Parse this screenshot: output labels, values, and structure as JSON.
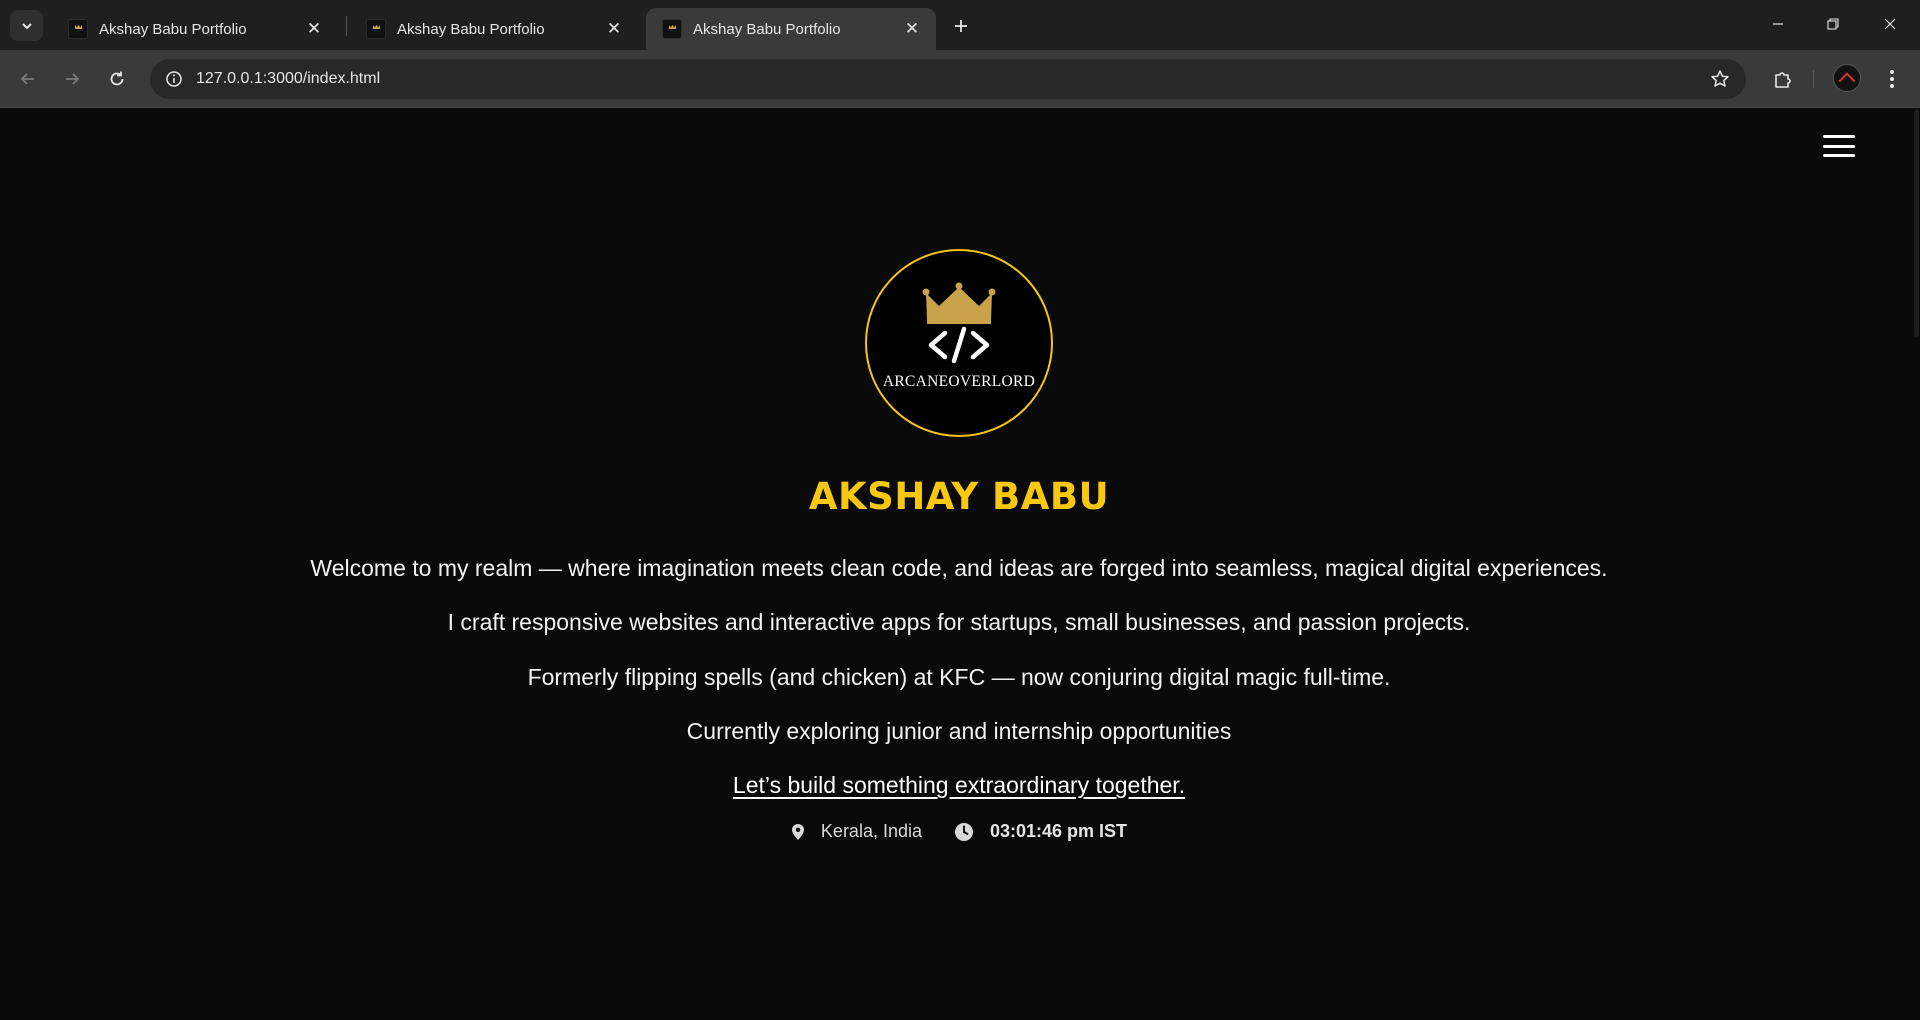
{
  "browser": {
    "tabs": [
      {
        "title": "Akshay Babu Portfolio",
        "active": false
      },
      {
        "title": "Akshay Babu Portfolio",
        "active": false
      },
      {
        "title": "Akshay Babu Portfolio",
        "active": true
      }
    ],
    "url": "127.0.0.1:3000/index.html",
    "icons": [
      "tab-search-icon",
      "close-icon",
      "plus-icon",
      "minimize-icon",
      "restore-icon",
      "back-icon",
      "forward-icon",
      "reload-icon",
      "site-info-icon",
      "bookmark-star-icon",
      "extensions-icon",
      "profile-avatar",
      "kebab-menu-icon"
    ]
  },
  "page": {
    "logo_text": "ARCANEOVERLORD",
    "name": "AKSHAY BABU",
    "lines": [
      "Welcome to my realm — where imagination meets clean code, and ideas are forged into seamless, magical digital experiences.",
      "I craft responsive websites and interactive apps for startups, small businesses, and passion projects.",
      "Formerly flipping spells (and chicken) at KFC — now conjuring digital magic full-time.",
      "Currently exploring junior and internship opportunities"
    ],
    "cta": "Let’s build something extraordinary together.",
    "location": "Kerala, India",
    "time": "03:01:46 pm IST",
    "colors": {
      "accent": "#f8c80f",
      "background": "#0a0a0a",
      "crown": "#c9a24a"
    }
  }
}
